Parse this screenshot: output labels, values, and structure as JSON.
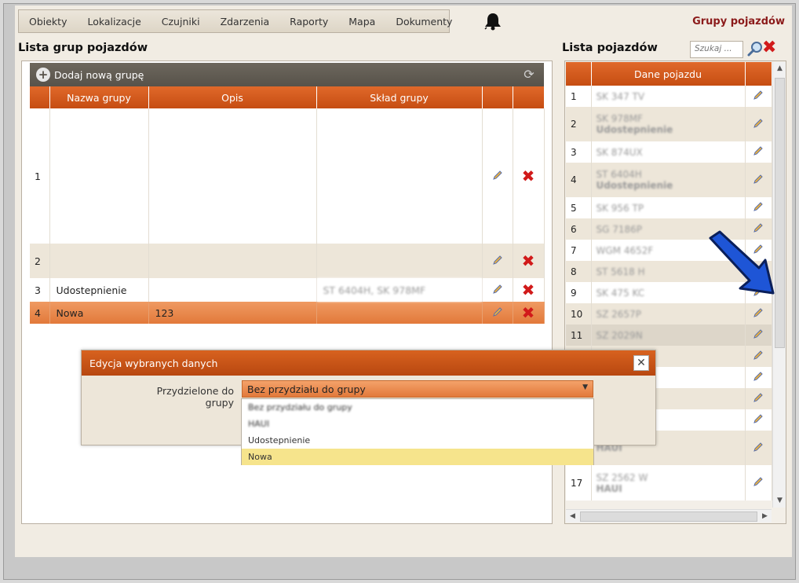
{
  "menu": [
    "Obiekty",
    "Lokalizacje",
    "Czujniki",
    "Zdarzenia",
    "Raporty",
    "Mapa",
    "Dokumenty"
  ],
  "page_heading": "Grupy pojazdów",
  "left": {
    "title": "Lista grup pojazdów",
    "add_label": "Dodaj nową grupę",
    "columns": [
      "Nazwa grupy",
      "Opis",
      "Skład grupy"
    ],
    "rows": [
      {
        "num": "1",
        "name": "",
        "desc": "",
        "members": ""
      },
      {
        "num": "2",
        "name": "",
        "desc": "",
        "members": ""
      },
      {
        "num": "3",
        "name": "Udostepnienie",
        "desc": "",
        "members": "ST 6404H, SK 978MF"
      },
      {
        "num": "4",
        "name": "Nowa",
        "desc": "123",
        "members": ""
      }
    ]
  },
  "right": {
    "title": "Lista pojazdów",
    "search_placeholder": "Szukaj ...",
    "column": "Dane pojazdu",
    "rows": [
      {
        "num": "1",
        "plate": "SK 347 TV",
        "sub": ""
      },
      {
        "num": "2",
        "plate": "SK 978MF",
        "sub": "Udostepnienie"
      },
      {
        "num": "3",
        "plate": "SK 874UX",
        "sub": ""
      },
      {
        "num": "4",
        "plate": "ST 6404H",
        "sub": "Udostepnienie"
      },
      {
        "num": "5",
        "plate": "SK 956 TP",
        "sub": ""
      },
      {
        "num": "6",
        "plate": "SG 7186P",
        "sub": ""
      },
      {
        "num": "7",
        "plate": "WGM 4652F",
        "sub": ""
      },
      {
        "num": "8",
        "plate": "ST 5618 H",
        "sub": ""
      },
      {
        "num": "9",
        "plate": "SK 475 KC",
        "sub": ""
      },
      {
        "num": "10",
        "plate": "SZ 2657P",
        "sub": ""
      },
      {
        "num": "11",
        "plate": "SZ 2029N",
        "sub": ""
      },
      {
        "num": "",
        "plate": "",
        "sub": ""
      },
      {
        "num": "",
        "plate": "",
        "sub": ""
      },
      {
        "num": "",
        "plate": "",
        "sub": ""
      },
      {
        "num": "",
        "plate": "",
        "sub": ""
      },
      {
        "num": "",
        "plate": "",
        "sub": "HAUI"
      },
      {
        "num": "17",
        "plate": "SZ 2562 W",
        "sub": "HAUI"
      }
    ]
  },
  "dialog": {
    "title": "Edycja wybranych danych",
    "label": "Przydzielone do grupy",
    "selected": "Bez przydziału do grupy",
    "options": [
      "Bez przydziału do grupy",
      "HAUI",
      "Udostepnienie",
      "Nowa"
    ]
  },
  "colors": {
    "accent": "#c64d12",
    "heading": "#8b1a1a",
    "highlight": "#f6e48c",
    "delete": "#d11a1a"
  }
}
